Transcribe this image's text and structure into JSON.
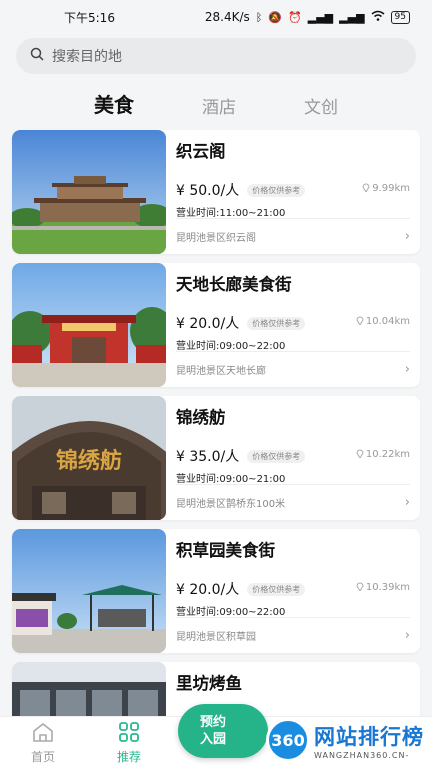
{
  "status": {
    "time": "下午5:16",
    "speed": "28.4K/s",
    "battery": "95"
  },
  "search": {
    "placeholder": "搜索目的地"
  },
  "tabs": [
    {
      "label": "美食"
    },
    {
      "label": "酒店"
    },
    {
      "label": "文创"
    }
  ],
  "price_note": "价格仅供参考",
  "items": [
    {
      "name": "织云阁",
      "price": "¥ 50.0/人",
      "hours": "营业时间:11:00~21:00",
      "distance": "9.99km",
      "location": "昆明池景区织云阁"
    },
    {
      "name": "天地长廊美食街",
      "price": "¥ 20.0/人",
      "hours": "营业时间:09:00~22:00",
      "distance": "10.04km",
      "location": "昆明池景区天地长廊"
    },
    {
      "name": "锦绣舫",
      "price": "¥ 35.0/人",
      "hours": "营业时间:09:00~21:00",
      "distance": "10.22km",
      "location": "昆明池景区鹊桥东100米"
    },
    {
      "name": "积草园美食街",
      "price": "¥ 20.0/人",
      "hours": "营业时间:09:00~22:00",
      "distance": "10.39km",
      "location": "昆明池景区积草园"
    },
    {
      "name": "里坊烤鱼"
    }
  ],
  "image_text": {
    "sign3": "锦绣舫"
  },
  "nav": {
    "home": "首页",
    "recommend": "推荐",
    "fab_line1": "预约",
    "fab_line2": "入园"
  },
  "watermark": {
    "logo": "360",
    "main": "网站排行榜",
    "sub": "WANGZHAN360.CN-"
  }
}
